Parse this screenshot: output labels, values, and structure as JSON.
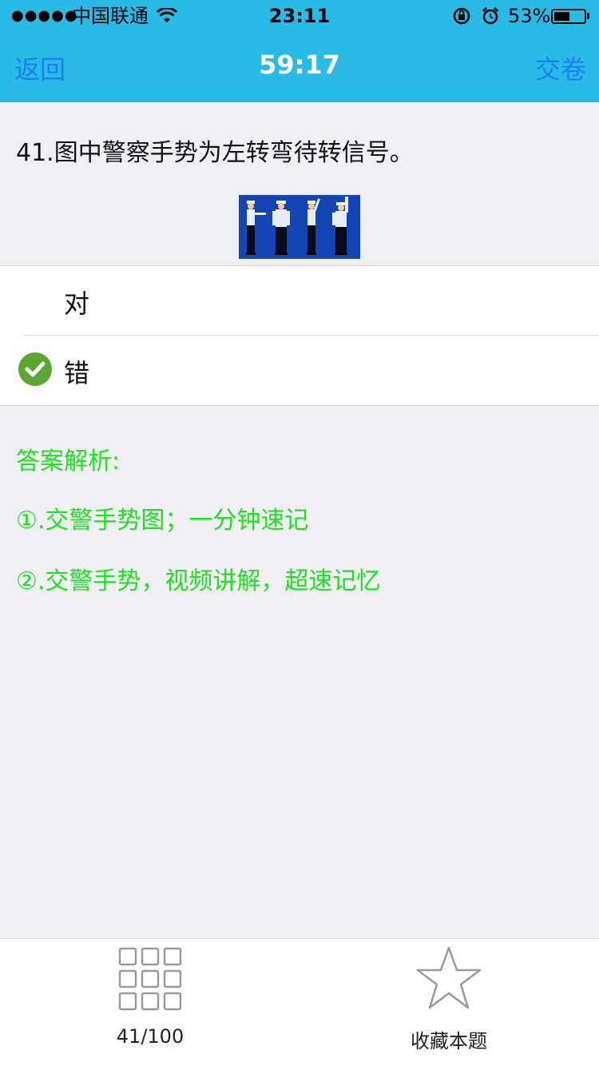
{
  "status_bar": {
    "signal": "●●●●●",
    "carrier": "中国联通",
    "wifi_icon": "wifi-icon",
    "time": "23:11",
    "rotation_lock_icon": "rotation-lock-icon",
    "alarm_icon": "alarm-icon",
    "battery_percent": "53%",
    "battery_level": 0.53
  },
  "nav": {
    "back": "返回",
    "timer": "59:17",
    "submit": "交卷"
  },
  "question": {
    "text": "41.图中警察手势为左转弯待转信号。"
  },
  "options": [
    {
      "label": "对",
      "selected": false
    },
    {
      "label": "错",
      "selected": true
    }
  ],
  "analysis": {
    "title": "答案解析:",
    "items": [
      "①.交警手势图；一分钟速记",
      "②.交警手势，视频讲解，超速记忆"
    ]
  },
  "tab_bar": {
    "progress": "41/100",
    "favorite": "收藏本题"
  },
  "colors": {
    "bar_bg": "#29bbe6",
    "link_blue": "#1a7ff0",
    "analysis_green": "#1fe21f",
    "check_green": "#5ba532",
    "image_bg": "#1445b3"
  }
}
